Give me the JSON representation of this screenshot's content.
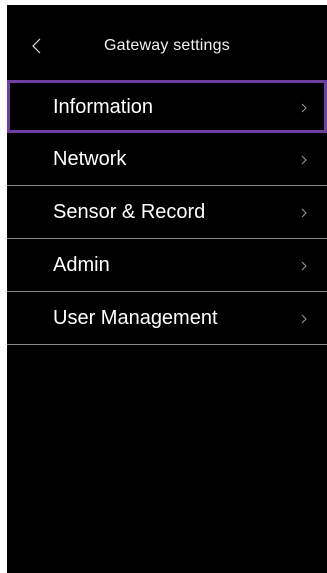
{
  "header": {
    "title": "Gateway settings",
    "back_icon": "chevron-left-icon"
  },
  "menu": {
    "items": [
      {
        "label": "Information",
        "icon": "chevron-right-icon",
        "selected": true
      },
      {
        "label": "Network",
        "icon": "chevron-right-icon",
        "selected": false
      },
      {
        "label": "Sensor & Record",
        "icon": "chevron-right-icon",
        "selected": false
      },
      {
        "label": "Admin",
        "icon": "chevron-right-icon",
        "selected": false
      },
      {
        "label": "User Management",
        "icon": "chevron-right-icon",
        "selected": false
      }
    ]
  },
  "colors": {
    "background": "#000000",
    "divider": "#8a8a8a",
    "focus": "#6f3fa0",
    "text": "#ffffff"
  }
}
